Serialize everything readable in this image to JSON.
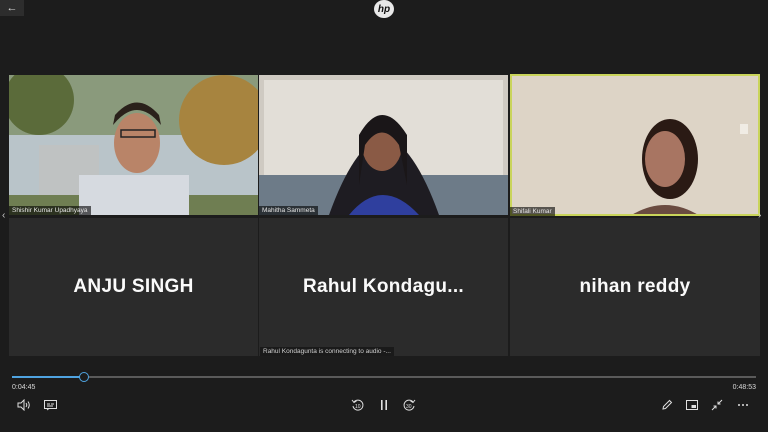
{
  "window": {
    "back_glyph": "←",
    "logo_text": "hp"
  },
  "participants": [
    {
      "name": "Shishir Kumar Upadhyaya",
      "video": true
    },
    {
      "name": "Mahitha Sammeta",
      "video": true
    },
    {
      "name": "Shifali Kumar",
      "video": true,
      "active_speaker": true
    },
    {
      "name": "ANJU SINGH",
      "video": false
    },
    {
      "name": "Rahul  Kondagu...",
      "video": false
    },
    {
      "name": "nihan reddy",
      "video": false
    }
  ],
  "status_toast": "Rahul Kondagunta is connecting to audio -...",
  "player": {
    "current_time": "0:04:45",
    "total_time": "0:48:53",
    "progress": 0.097
  },
  "colors": {
    "accent": "#4fa3e0",
    "active_border": "#c9d45a",
    "background": "#1c1c1c"
  },
  "icons": {
    "volume": "volume-icon",
    "captions": "captions-icon",
    "rewind": "rewind-10-icon",
    "pause": "pause-icon",
    "forward": "forward-30-icon",
    "edit": "edit-icon",
    "miniview": "mini-view-icon",
    "exit_full_screen": "exit-full-screen-icon",
    "more": "more-icon"
  }
}
